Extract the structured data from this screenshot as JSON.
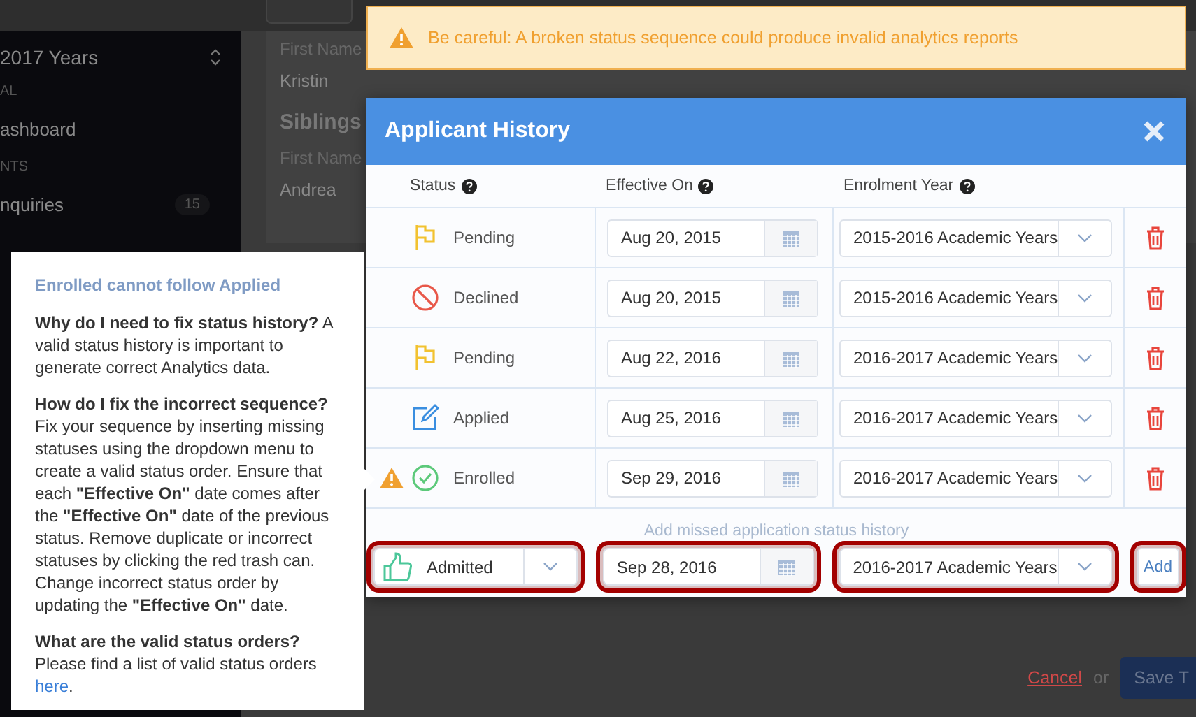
{
  "sidebar": {
    "year_selector": "2017 Years",
    "items": [
      {
        "kind": "section",
        "label": "AL"
      },
      {
        "kind": "link",
        "label": "ashboard"
      },
      {
        "kind": "section",
        "label": "NTS"
      },
      {
        "kind": "link",
        "label": "nquiries",
        "badge": "15"
      }
    ]
  },
  "profile": {
    "parents_label": "First Name",
    "parents_value": "Kristin",
    "siblings_heading": "Siblings",
    "siblings_label": "First Name",
    "siblings_value": "Andrea"
  },
  "footer": {
    "cancel": "Cancel",
    "or": "or",
    "save": "Save T"
  },
  "banner": {
    "text": "Be careful: A broken status sequence could produce invalid analytics reports"
  },
  "modal": {
    "title": "Applicant History",
    "columns": [
      "Status",
      "Effective On",
      "Enrolment Year"
    ],
    "rows": [
      {
        "kind": "pending",
        "status": "Pending",
        "date": "Aug 20, 2015",
        "year": "2015-2016 Academic Years",
        "warning": false
      },
      {
        "kind": "declined",
        "status": "Declined",
        "date": "Aug 20, 2015",
        "year": "2015-2016 Academic Years",
        "warning": false
      },
      {
        "kind": "pending",
        "status": "Pending",
        "date": "Aug 22, 2016",
        "year": "2016-2017 Academic Years",
        "warning": false
      },
      {
        "kind": "applied",
        "status": "Applied",
        "date": "Aug 25, 2016",
        "year": "2016-2017 Academic Years",
        "warning": false
      },
      {
        "kind": "enrolled",
        "status": "Enrolled",
        "date": "Sep 29, 2016",
        "year": "2016-2017 Academic Years",
        "warning": true
      }
    ],
    "add_hint": "Add missed application status history",
    "new_entry": {
      "kind": "admitted",
      "status": "Admitted",
      "date": "Sep 28, 2016",
      "year": "2016-2017 Academic Years",
      "button": "Add",
      "highlighted": true
    }
  },
  "tooltip": {
    "title": "Enrolled cannot follow Applied",
    "paragraphs": [
      {
        "text": "**Why do I need to fix status history?** A valid status history is important to generate correct Analytics data."
      },
      {
        "text": "**How do I fix the incorrect sequence?** Fix your sequence by inserting missing statuses using the dropdown menu to create a valid status order. Ensure that each **\"Effective On\"** date comes after the **\"Effective On\"** date of the previous status. Remove duplicate or incorrect statuses by clicking the red trash can. Change incorrect status order by updating the **\"Effective On\"** date."
      },
      {
        "text": "**What are the valid status orders?** Please find a list of valid status orders ",
        "link": "here",
        "after": "."
      }
    ]
  }
}
